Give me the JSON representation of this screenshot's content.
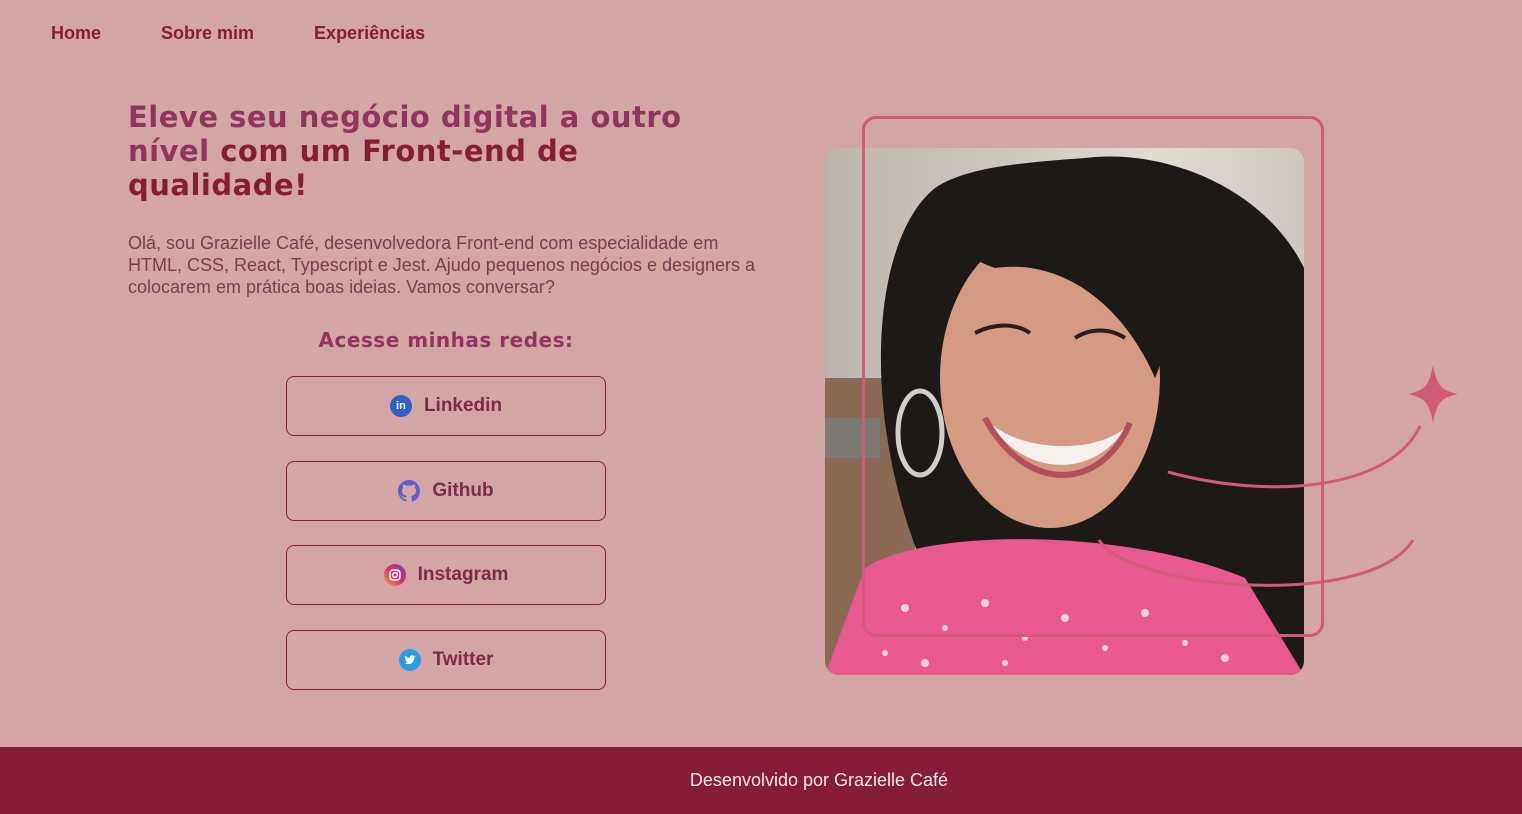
{
  "nav": {
    "items": [
      {
        "label": "Home"
      },
      {
        "label": "Sobre mim"
      },
      {
        "label": "Experiências"
      }
    ]
  },
  "hero": {
    "headline_part1": "Eleve seu negócio digital a outro nível",
    "headline_part2": " com um Front-end de qualidade!",
    "intro": "Olá, sou Grazielle Café, desenvolvedora Front-end com especialidade em HTML, CSS, React, Typescript e Jest. Ajudo pequenos negócios e designers a colocarem em prática boas ideias. Vamos conversar?",
    "social_title": "Acesse minhas redes:",
    "social": [
      {
        "label": "Linkedin",
        "icon": "linkedin-icon"
      },
      {
        "label": "Github",
        "icon": "github-icon"
      },
      {
        "label": "Instagram",
        "icon": "instagram-icon"
      },
      {
        "label": "Twitter",
        "icon": "twitter-icon"
      }
    ]
  },
  "footer": {
    "text": "Desenvolvido por Grazielle Café"
  },
  "colors": {
    "background": "#d4a5a5",
    "accent": "#861d38",
    "frame": "#d05a78"
  }
}
